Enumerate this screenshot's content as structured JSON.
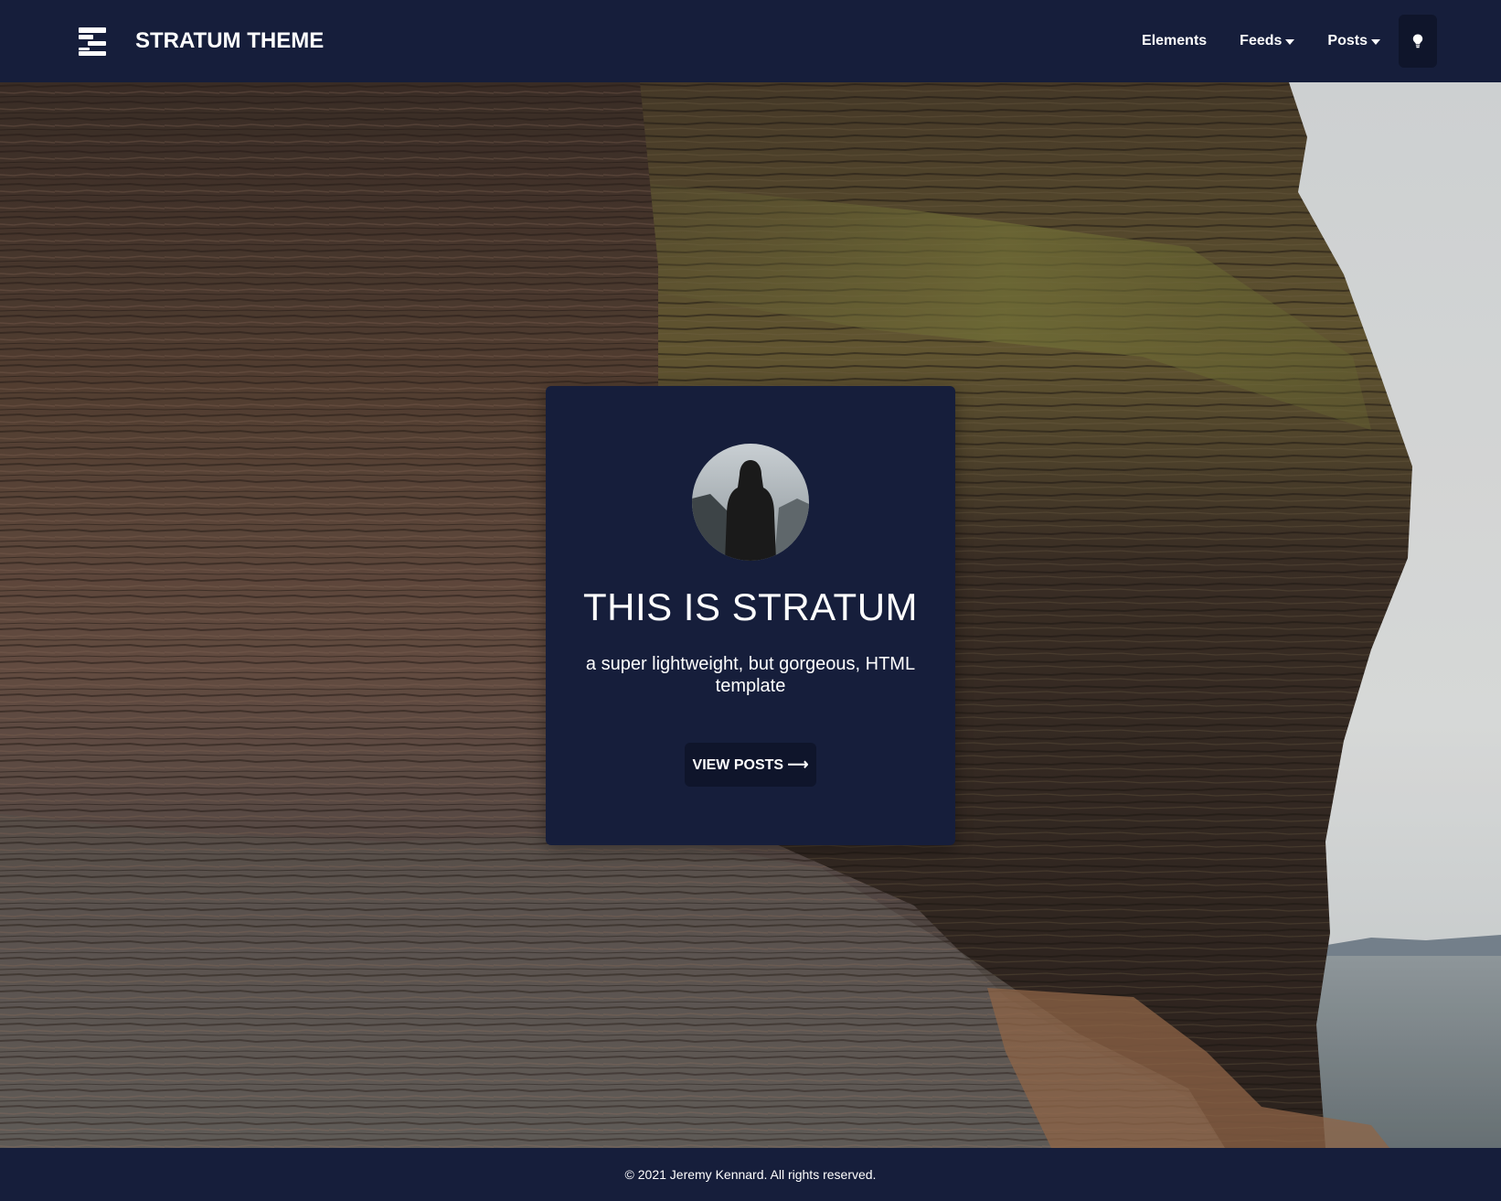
{
  "navbar": {
    "brand": "STRATUM THEME",
    "links": [
      {
        "label": "Elements"
      },
      {
        "label": "Feeds"
      },
      {
        "label": "Posts"
      }
    ],
    "theme_toggle_icon": "lightbulb-icon"
  },
  "hero": {
    "title": "THIS IS STRATUM",
    "subtitle": "a super lightweight, but gorgeous, HTML template",
    "button_label": "VIEW POSTS ⟶"
  },
  "footer": {
    "text": "© 2021 Jeremy Kennard. All rights reserved."
  },
  "colors": {
    "navy": "#161e3b",
    "button": "#0f152b",
    "text": "#ffffff"
  }
}
